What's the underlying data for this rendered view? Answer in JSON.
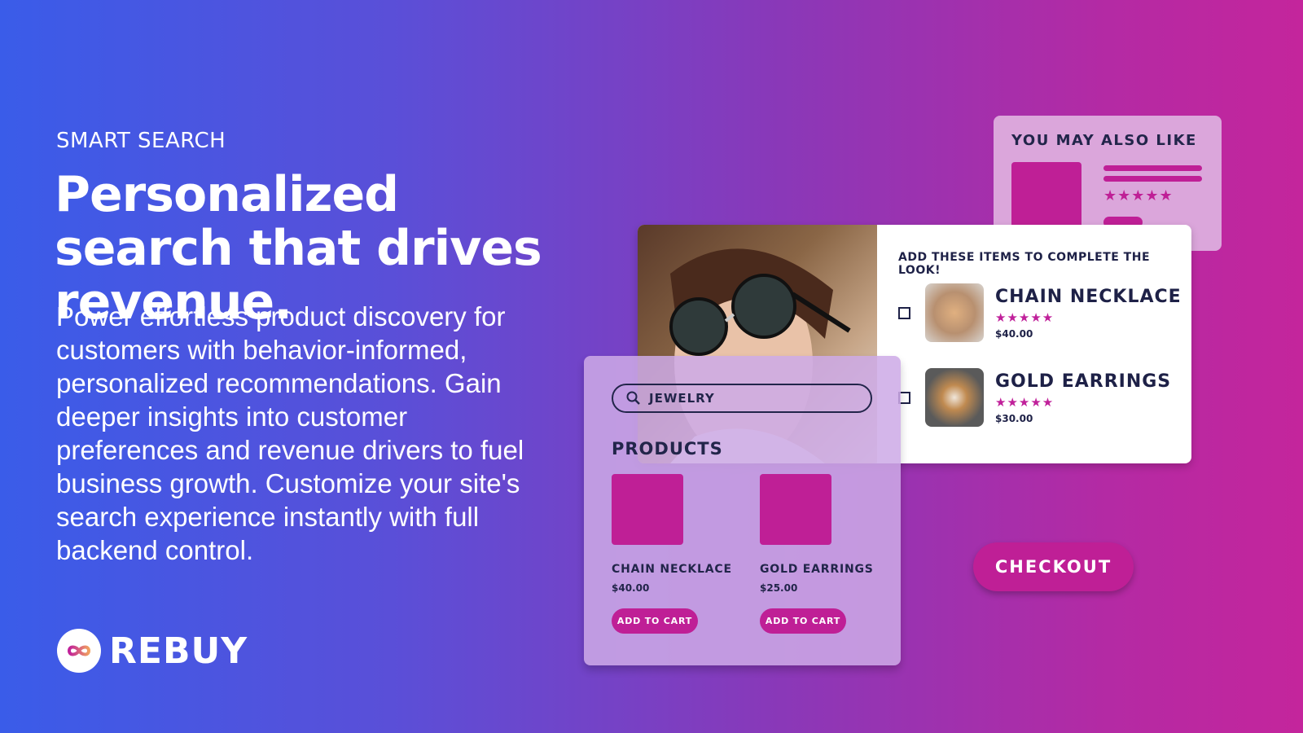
{
  "hero": {
    "eyebrow": "SMART SEARCH",
    "headline": "Personalized search that drives revenue.",
    "description": "Power effortless product discovery for customers with behavior-informed, personalized recommendations. Gain deeper insights into customer preferences and revenue drivers to fuel business growth. Customize your site's search experience instantly with full backend control."
  },
  "brand": {
    "name": "REBUY",
    "accent": "#bf1f96"
  },
  "ymal": {
    "title": "YOU MAY ALSO LIKE",
    "stars": "★★★★★"
  },
  "complete_look": {
    "title": "ADD THESE ITEMS TO COMPLETE THE LOOK!",
    "items": [
      {
        "name": "CHAIN NECKLACE",
        "stars": "★★★★★",
        "price": "$40.00"
      },
      {
        "name": "GOLD EARRINGS",
        "stars": "★★★★★",
        "price": "$30.00"
      }
    ]
  },
  "search": {
    "value": "JEWELRY",
    "icon": "search-icon"
  },
  "products": {
    "label": "PRODUCTS",
    "items": [
      {
        "name": "CHAIN NECKLACE",
        "price": "$40.00",
        "button": "ADD TO CART"
      },
      {
        "name": "GOLD EARRINGS",
        "price": "$25.00",
        "button": "ADD TO CART"
      }
    ]
  },
  "checkout": {
    "label": "CHECKOUT"
  }
}
